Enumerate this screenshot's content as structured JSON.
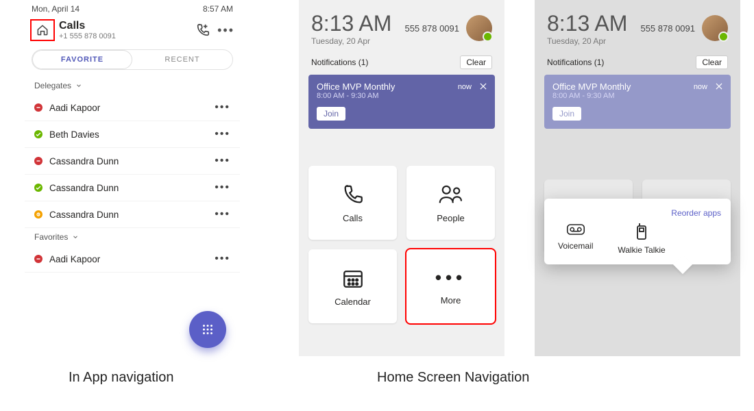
{
  "captions": {
    "in_app": "In App navigation",
    "home_screen": "Home Screen Navigation"
  },
  "panel1": {
    "status_date": "Mon, April 14",
    "status_time": "8:57 AM",
    "title": "Calls",
    "phone": "+1 555 878 0091",
    "tabs": {
      "favorite": "FAVORITE",
      "recent": "RECENT"
    },
    "sections": {
      "delegates": "Delegates",
      "favorites": "Favorites"
    },
    "contacts": {
      "delegates": [
        {
          "name": "Aadi Kapoor",
          "status": "red"
        },
        {
          "name": "Beth Davies",
          "status": "green"
        },
        {
          "name": "Cassandra Dunn",
          "status": "red"
        },
        {
          "name": "Cassandra Dunn",
          "status": "green"
        },
        {
          "name": "Cassandra Dunn",
          "status": "orange"
        }
      ],
      "favorites": [
        {
          "name": "Aadi Kapoor",
          "status": "red"
        }
      ]
    }
  },
  "home": {
    "time": "8:13 AM",
    "date": "Tuesday, 20 Apr",
    "phone": "555 878 0091",
    "notifications_label": "Notifications (1)",
    "clear": "Clear",
    "notif": {
      "title": "Office MVP Monthly",
      "subtitle": "8:00 AM - 9:30 AM",
      "now": "now",
      "join": "Join"
    },
    "tiles": {
      "calls": "Calls",
      "people": "People",
      "calendar": "Calendar",
      "more": "More"
    },
    "popover": {
      "reorder": "Reorder apps",
      "voicemail": "Voicemail",
      "walkie": "Walkie Talkie"
    }
  }
}
